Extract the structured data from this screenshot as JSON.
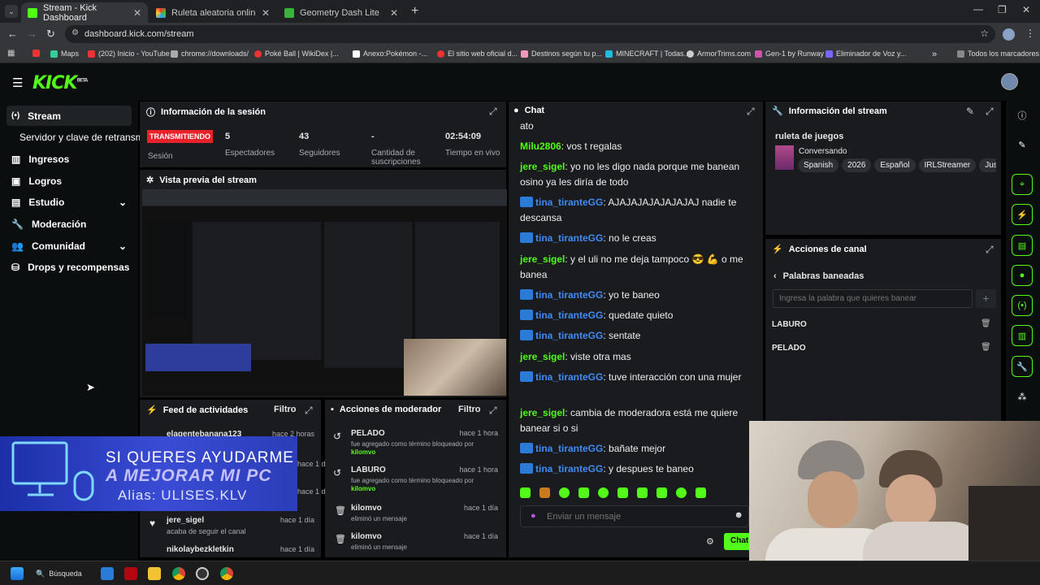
{
  "browser": {
    "tabs": [
      {
        "title": "Stream - Kick Dashboard",
        "active": true
      },
      {
        "title": "Ruleta aleatoria online – ruleta",
        "active": false
      },
      {
        "title": "Geometry Dash Lite",
        "active": false
      }
    ],
    "new_tab": "+",
    "url": "dashboard.kick.com/stream",
    "bookmarks": [
      "Maps",
      "(202) Inicio - YouTube",
      "chrome://downloads/",
      "Poké Ball | WikiDex |...",
      "Anexo:Pokémon -...",
      "El sitio web oficial d...",
      "Destinos según tu p...",
      "MINECRAFT | Todas...",
      "ArmorTrims.com",
      "Gen-1 by Runway",
      "Eliminador de Voz y...",
      "Todos los marcadores"
    ]
  },
  "kick": {
    "logo": "KICK",
    "logo_sup": "BETA",
    "sidebar": [
      {
        "label": "Stream",
        "icon": "broadcast-icon",
        "active": true
      },
      {
        "label": "Servidor y clave de retransmisión",
        "icon": "",
        "active": false
      },
      {
        "label": "Ingresos",
        "icon": "bar-chart-icon",
        "active": false
      },
      {
        "label": "Logros",
        "icon": "trophy-icon",
        "active": false
      },
      {
        "label": "Estudio",
        "icon": "studio-icon",
        "active": false
      },
      {
        "label": "Moderación",
        "icon": "wrench-icon",
        "active": false
      },
      {
        "label": "Comunidad",
        "icon": "community-icon",
        "active": false
      },
      {
        "label": "Drops y recompensas",
        "icon": "gift-icon",
        "active": false
      }
    ],
    "session": {
      "title": "Información de la sesión",
      "status": "TRANSMITIENDO",
      "status_label": "Sesión",
      "stats": [
        {
          "value": "5",
          "label": "Espectadores"
        },
        {
          "value": "43",
          "label": "Seguidores"
        },
        {
          "value": "-",
          "label": "Cantidad de suscripciones"
        },
        {
          "value": "02:54:09",
          "label": "Tiempo en vivo"
        }
      ]
    },
    "preview": {
      "title": "Vista previa del stream"
    },
    "feed": {
      "title": "Feed de actividades",
      "filter": "Filtro",
      "items": [
        {
          "user": "elagentebanana123",
          "time": "hace 2 horas",
          "action": ""
        },
        {
          "user": "jere_sigel",
          "time": "hace 1 día",
          "action": "acaba de seguir el canal"
        },
        {
          "user": "nikolaybezkletkin",
          "time": "hace 1 día",
          "action": ""
        }
      ],
      "partial_times": [
        "hace 1 día",
        "hace 1 día"
      ]
    },
    "overlay": {
      "line1": "SI QUERES AYUDARME",
      "line2": "A MEJORAR MI PC",
      "line3": "Alias: ULISES.KLV"
    },
    "mod_actions": {
      "title": "Acciones de moderador",
      "filter": "Filtro",
      "items": [
        {
          "title": "PELADO",
          "desc": "fue agregado como término bloqueado por",
          "by": "kilomvo",
          "time": "hace 1 hora"
        },
        {
          "title": "LABURO",
          "desc": "fue agregado como término bloqueado por",
          "by": "kilomvo",
          "time": "hace 1 hora"
        },
        {
          "title": "kilomvo",
          "desc": "eliminó un mensaje",
          "by": "",
          "time": "hace 1 día"
        },
        {
          "title": "kilomvo",
          "desc": "eliminó un mensaje",
          "by": "",
          "time": "hace 1 día"
        }
      ]
    },
    "chat": {
      "title": "Chat",
      "messages": [
        {
          "user": "",
          "text": "ato",
          "badge": false,
          "color": "g"
        },
        {
          "user": "Milu2806",
          "text": ": vos t regalas",
          "badge": false,
          "color": "g"
        },
        {
          "user": "jere_sigel",
          "text": ": yo no les digo nada porque me banean osino ya les diría de todo",
          "badge": false,
          "color": "g"
        },
        {
          "user": "tina_tiranteGG",
          "text": ": AJAJAJAJAJAJAJAJ nadie te descansa",
          "badge": true,
          "color": "b"
        },
        {
          "user": "tina_tiranteGG",
          "text": ": no le creas",
          "badge": true,
          "color": "b"
        },
        {
          "user": "jere_sigel",
          "text": ": y el uli no me deja tampoco 😎 💪 o me banea",
          "badge": false,
          "color": "g"
        },
        {
          "user": "tina_tiranteGG",
          "text": ": yo te baneo",
          "badge": true,
          "color": "b"
        },
        {
          "user": "tina_tiranteGG",
          "text": ": quedate quieto",
          "badge": true,
          "color": "b"
        },
        {
          "user": "tina_tiranteGG",
          "text": ": sentate",
          "badge": true,
          "color": "b"
        },
        {
          "user": "jere_sigel",
          "text": ": viste otra mas",
          "badge": false,
          "color": "g"
        },
        {
          "user": "tina_tiranteGG",
          "text": ": tuve interacción con una mujer",
          "badge": true,
          "color": "b"
        },
        {
          "user": "jere_sigel",
          "text": ": cambia de moderadora está me quiere banear si o si",
          "badge": false,
          "color": "g"
        },
        {
          "user": "tina_tiranteGG",
          "text": ": bañate mejor",
          "badge": true,
          "color": "b"
        },
        {
          "user": "tina_tiranteGG",
          "text": ": y despues te baneo",
          "badge": true,
          "color": "b"
        }
      ],
      "placeholder": "Enviar un mensaje",
      "send": "Chat"
    },
    "stream_info": {
      "title": "Información del stream",
      "stream_title": "ruleta de juegos",
      "category": "Conversando",
      "tags": [
        "Spanish",
        "2026",
        "Español",
        "IRLStreamer",
        "JustC"
      ]
    },
    "channel_actions": {
      "title": "Acciones de canal",
      "back_label": "Palabras baneadas",
      "input_placeholder": "Ingresa la palabra que quieres banear",
      "add": "+",
      "words": [
        "LABURO",
        "PELADO"
      ]
    }
  },
  "taskbar": {
    "search": "Búsqueda"
  },
  "colors": {
    "accent": "#53fc18",
    "live": "#e8222b",
    "panel": "#191b1f",
    "mod_blue": "#3f8cf5"
  }
}
